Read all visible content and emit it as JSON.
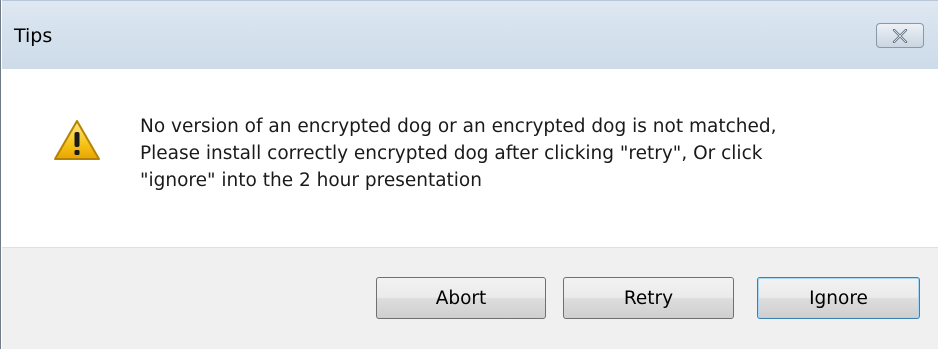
{
  "window": {
    "title": "Tips",
    "close_icon": "close-icon"
  },
  "dialog": {
    "icon": "warning-icon",
    "message_lines": [
      "No version of an encrypted dog or an encrypted dog is not matched,",
      "Please install correctly encrypted dog after clicking \"retry\", Or click",
      "\"ignore\" into the 2 hour presentation"
    ]
  },
  "buttons": {
    "abort": "Abort",
    "retry": "Retry",
    "ignore": "Ignore"
  },
  "colors": {
    "titlebar": "#d6e2ee",
    "footer": "#f0f0f0",
    "warning_yellow": "#f6c41a"
  }
}
